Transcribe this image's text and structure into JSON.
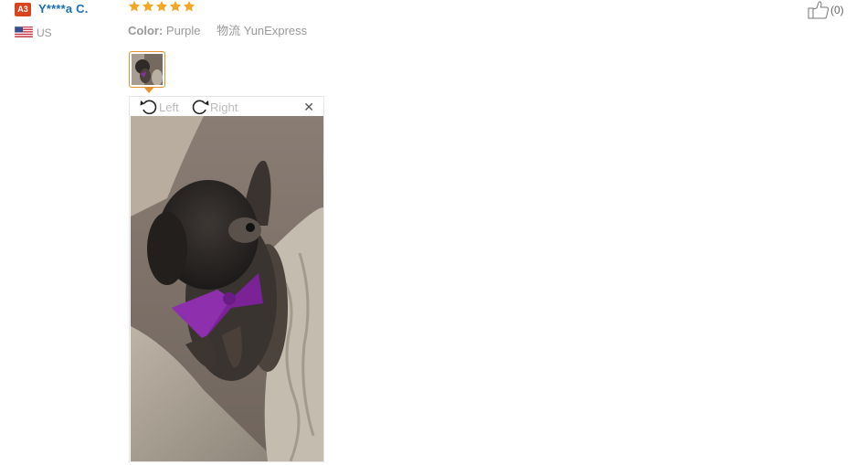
{
  "reviewer": {
    "level_badge": "A3",
    "name": "Y****a C.",
    "country_code": "US",
    "flag_icon": "us-flag-icon"
  },
  "review": {
    "rating": 5,
    "rating_max": 5,
    "star_color": "#f5a623",
    "color_label": "Color:",
    "color_value": "Purple",
    "shipping_label": "物流",
    "shipping_value": "YunExpress"
  },
  "helpful": {
    "count_text": "(0)",
    "icon": "thumbs-up-icon"
  },
  "viewer": {
    "rotate_left_label": "Left",
    "rotate_right_label": "Right",
    "close_symbol": "✕"
  },
  "colors": {
    "link_blue": "#1a6fb3",
    "badge_red": "#d9441f",
    "accent_orange": "#e8902d"
  }
}
